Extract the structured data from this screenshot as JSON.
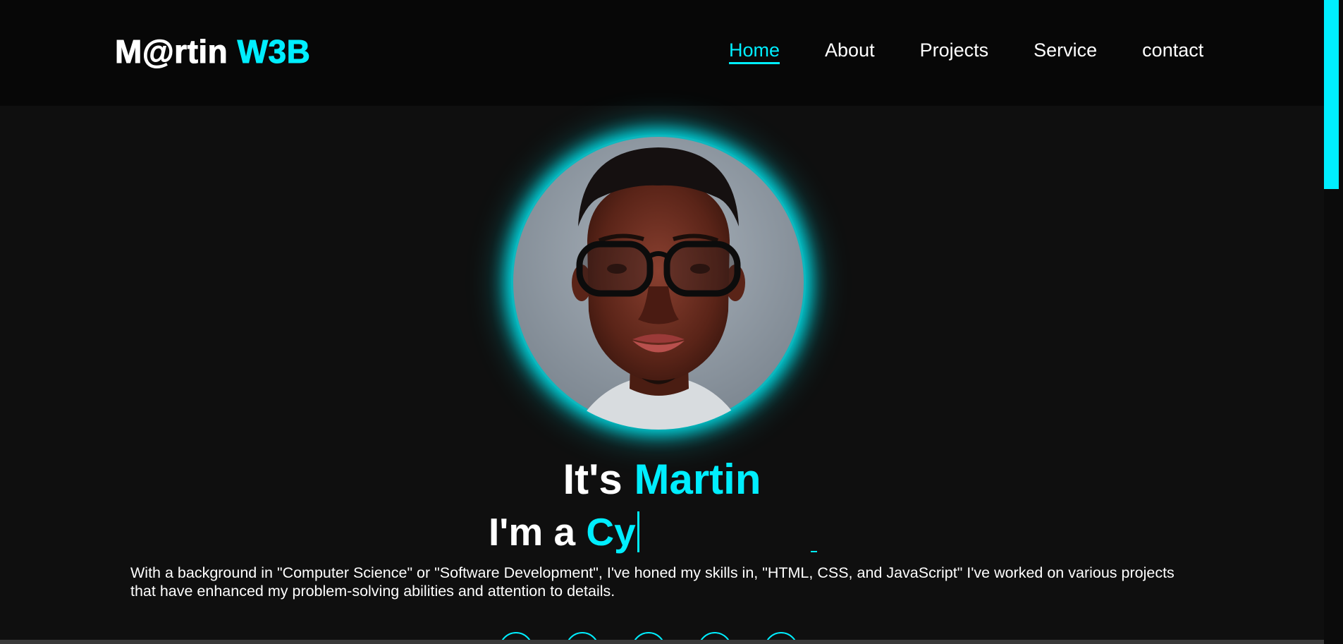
{
  "header": {
    "logo_main": "M@rtin ",
    "logo_accent": "W3B",
    "nav": [
      {
        "label": "Home",
        "active": true
      },
      {
        "label": "About",
        "active": false
      },
      {
        "label": "Projects",
        "active": false
      },
      {
        "label": "Service",
        "active": false
      },
      {
        "label": "contact",
        "active": false
      }
    ]
  },
  "hero": {
    "greeting": "It's ",
    "name": "Martin",
    "typing_prefix": "I'm a ",
    "typing_text": "Cy",
    "description": "With a background in \"Computer Science\" or \"Software Development\", I've honed my skills in, \"HTML, CSS, and JavaScript\" I've worked on various projects that have enhanced my problem-solving abilities and attention to details."
  },
  "socials": [
    "social-link",
    "social-link",
    "social-link",
    "social-link",
    "social-link"
  ],
  "colors": {
    "accent": "#00eeff",
    "background": "#0f0f0f",
    "header_bg": "#070707"
  }
}
